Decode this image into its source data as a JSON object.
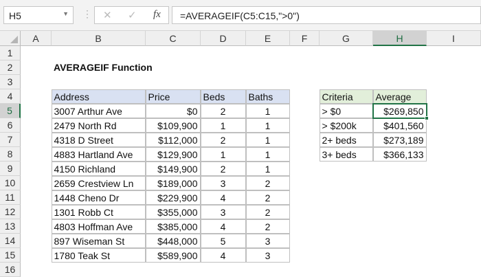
{
  "name_box": "H5",
  "formula": "=AVERAGEIF(C5:C15,\">0\")",
  "icons": {
    "cancel": "✕",
    "enter": "✓",
    "fx": "fx"
  },
  "columns": [
    "A",
    "B",
    "C",
    "D",
    "E",
    "F",
    "G",
    "H",
    "I"
  ],
  "rows": [
    "1",
    "2",
    "3",
    "4",
    "5",
    "6",
    "7",
    "8",
    "9",
    "10",
    "11",
    "12",
    "13",
    "14",
    "15",
    "16"
  ],
  "selected": {
    "column": "H",
    "row": "5"
  },
  "title": "AVERAGEIF Function",
  "main_table": {
    "headers": [
      "Address",
      "Price",
      "Beds",
      "Baths"
    ],
    "rows": [
      [
        "3007 Arthur Ave",
        "$0",
        "2",
        "1"
      ],
      [
        "2479 North Rd",
        "$109,900",
        "1",
        "1"
      ],
      [
        "4318 D Street",
        "$112,000",
        "2",
        "1"
      ],
      [
        "4883 Hartland Ave",
        "$129,900",
        "1",
        "1"
      ],
      [
        "4150 Richland",
        "$149,900",
        "2",
        "1"
      ],
      [
        "2659 Crestview Ln",
        "$189,000",
        "3",
        "2"
      ],
      [
        "1448 Cheno Dr",
        "$229,900",
        "4",
        "2"
      ],
      [
        "1301 Robb Ct",
        "$355,000",
        "3",
        "2"
      ],
      [
        "4803 Hoffman Ave",
        "$385,000",
        "4",
        "2"
      ],
      [
        "897 Wiseman St",
        "$448,000",
        "5",
        "3"
      ],
      [
        "1780 Teak St",
        "$589,900",
        "4",
        "3"
      ]
    ]
  },
  "summary_table": {
    "headers": [
      "Criteria",
      "Average"
    ],
    "rows": [
      [
        "> $0",
        "$269,850"
      ],
      [
        "> $200k",
        "$401,560"
      ],
      [
        "2+ beds",
        "$273,189"
      ],
      [
        "3+ beds",
        "$366,133"
      ]
    ]
  }
}
